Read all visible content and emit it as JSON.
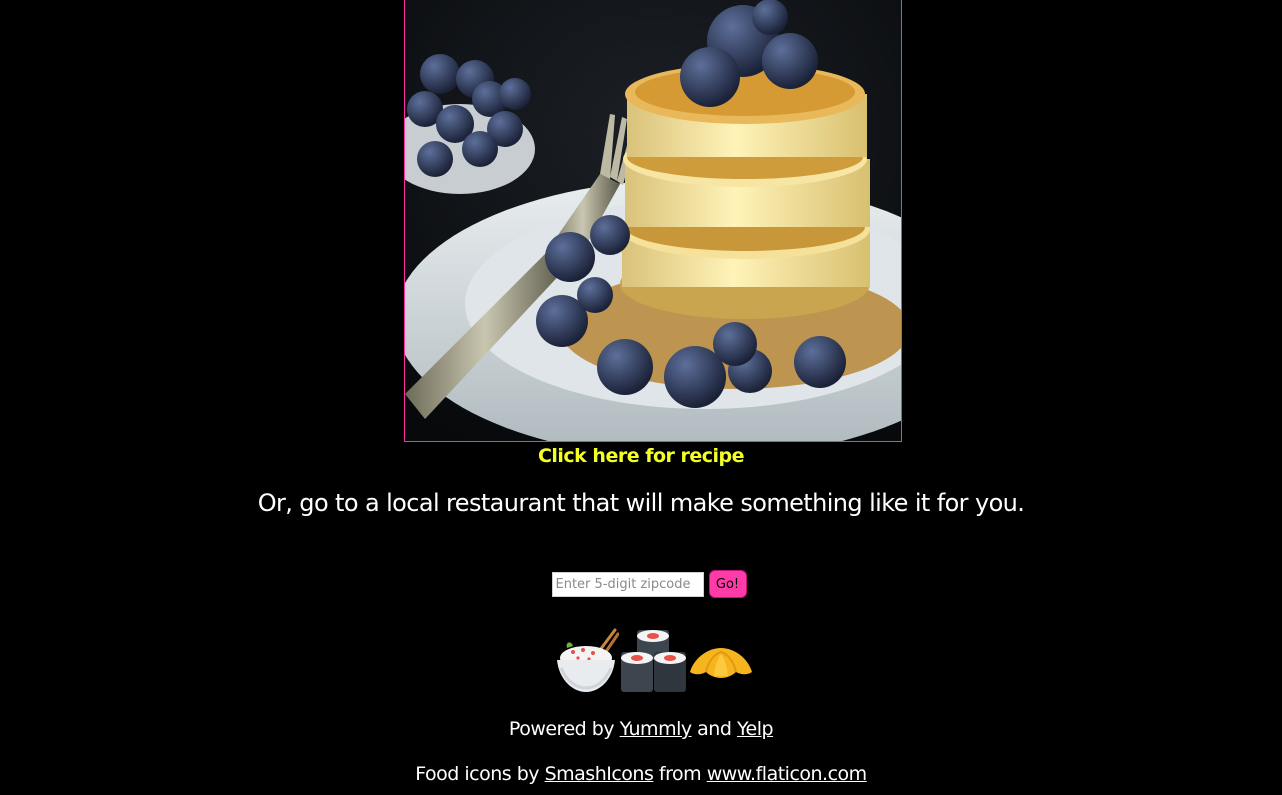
{
  "photo": {
    "alt": ""
  },
  "recipe_link": {
    "label": "Click here for recipe"
  },
  "tagline": "Or, go to a local restaurant that will make something like it for you.",
  "zip_search": {
    "placeholder": "Enter 5-digit zipcode",
    "value": "",
    "button_label": "Go!"
  },
  "food_icons": [
    {
      "icon": "rice-bowl-icon"
    },
    {
      "icon": "sushi-icon"
    },
    {
      "icon": "croissant-icon"
    }
  ],
  "credits": {
    "powered_prefix": "Powered by",
    "yummly_label": "Yummly",
    "and_text": "and",
    "yelp_label": "Yelp",
    "icons_prefix": "Food icons by",
    "smashicons_label": "SmashIcons",
    "from_text": "from",
    "flaticon_label": "www.flaticon.com"
  },
  "colors": {
    "background": "#000000",
    "link_yellow": "#f4ff24",
    "accent_pink": "#ff3ba8",
    "text": "#ffffff"
  }
}
